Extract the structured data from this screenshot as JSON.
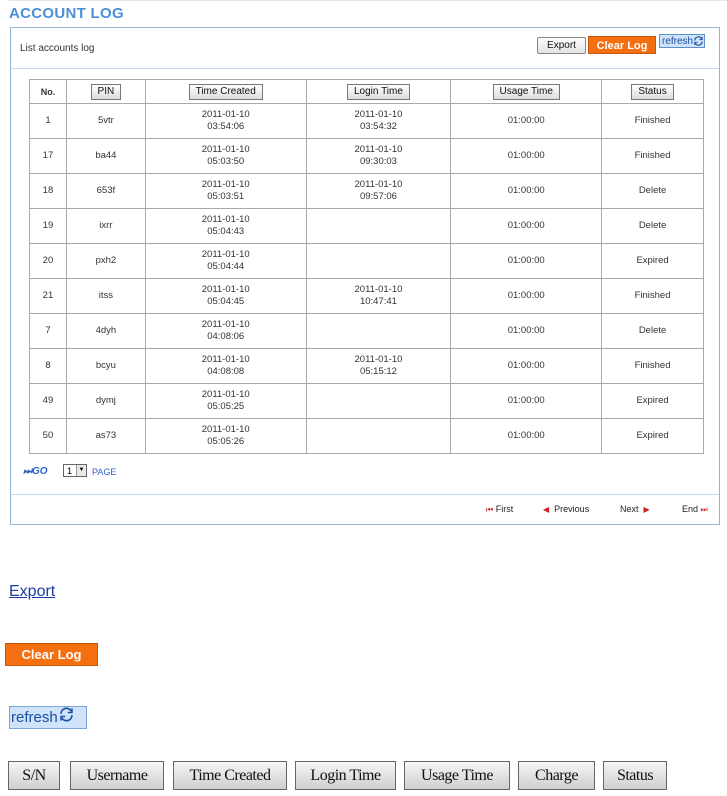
{
  "page": {
    "title": "ACCOUNT LOG"
  },
  "panel": {
    "subtitle": "List accounts log",
    "export_label": "Export",
    "clear_label": "Clear Log",
    "refresh_label": "refresh"
  },
  "table": {
    "headers": [
      "No.",
      "PIN",
      "Time Created",
      "Login Time",
      "Usage Time",
      "Status"
    ],
    "rows": [
      {
        "no": "1",
        "pin": "5vtr",
        "created_date": "2011-01-10",
        "created_time": "03:54:06",
        "login_date": "2011-01-10",
        "login_time": "03:54:32",
        "usage": "01:00:00",
        "status": "Finished"
      },
      {
        "no": "17",
        "pin": "ba44",
        "created_date": "2011-01-10",
        "created_time": "05:03:50",
        "login_date": "2011-01-10",
        "login_time": "09:30:03",
        "usage": "01:00:00",
        "status": "Finished"
      },
      {
        "no": "18",
        "pin": "653f",
        "created_date": "2011-01-10",
        "created_time": "05:03:51",
        "login_date": "2011-01-10",
        "login_time": "09:57:06",
        "usage": "01:00:00",
        "status": "Delete"
      },
      {
        "no": "19",
        "pin": "ixrr",
        "created_date": "2011-01-10",
        "created_time": "05:04:43",
        "login_date": "",
        "login_time": "",
        "usage": "01:00:00",
        "status": "Delete"
      },
      {
        "no": "20",
        "pin": "pxh2",
        "created_date": "2011-01-10",
        "created_time": "05:04:44",
        "login_date": "",
        "login_time": "",
        "usage": "01:00:00",
        "status": "Expired"
      },
      {
        "no": "21",
        "pin": "itss",
        "created_date": "2011-01-10",
        "created_time": "05:04:45",
        "login_date": "2011-01-10",
        "login_time": "10:47:41",
        "usage": "01:00:00",
        "status": "Finished"
      },
      {
        "no": "7",
        "pin": "4dyh",
        "created_date": "2011-01-10",
        "created_time": "04:08:06",
        "login_date": "",
        "login_time": "",
        "usage": "01:00:00",
        "status": "Delete"
      },
      {
        "no": "8",
        "pin": "bcyu",
        "created_date": "2011-01-10",
        "created_time": "04:08:08",
        "login_date": "2011-01-10",
        "login_time": "05:15:12",
        "usage": "01:00:00",
        "status": "Finished"
      },
      {
        "no": "49",
        "pin": "dymj",
        "created_date": "2011-01-10",
        "created_time": "05:05:25",
        "login_date": "",
        "login_time": "",
        "usage": "01:00:00",
        "status": "Expired"
      },
      {
        "no": "50",
        "pin": "as73",
        "created_date": "2011-01-10",
        "created_time": "05:05:26",
        "login_date": "",
        "login_time": "",
        "usage": "01:00:00",
        "status": "Expired"
      }
    ]
  },
  "status_colors": {
    "Finished": "#2e8b2e",
    "Delete": "#e06a1a",
    "Expired": "#222222"
  },
  "pager": {
    "go_label": "GO",
    "page_value": "1",
    "page_label": "PAGE",
    "first_label": "First",
    "previous_label": "Previous",
    "next_label": "Next",
    "end_label": "End"
  },
  "legend": {
    "export_link": "Export",
    "clear_label": "Clear Log",
    "refresh_label": "refresh",
    "header_buttons": [
      "S/N",
      "Username",
      "Time Created",
      "Login Time",
      "Usage Time",
      "Charge",
      "Status"
    ]
  },
  "colors": {
    "accent": "#4a8fd8",
    "clear_orange": "#f46f10",
    "refresh_bg": "#cfe3fb"
  },
  "icons": {
    "refresh": "refresh-icon",
    "first": "first-icon",
    "previous": "previous-icon",
    "next": "next-icon",
    "end": "end-icon",
    "go": "go-icon"
  }
}
